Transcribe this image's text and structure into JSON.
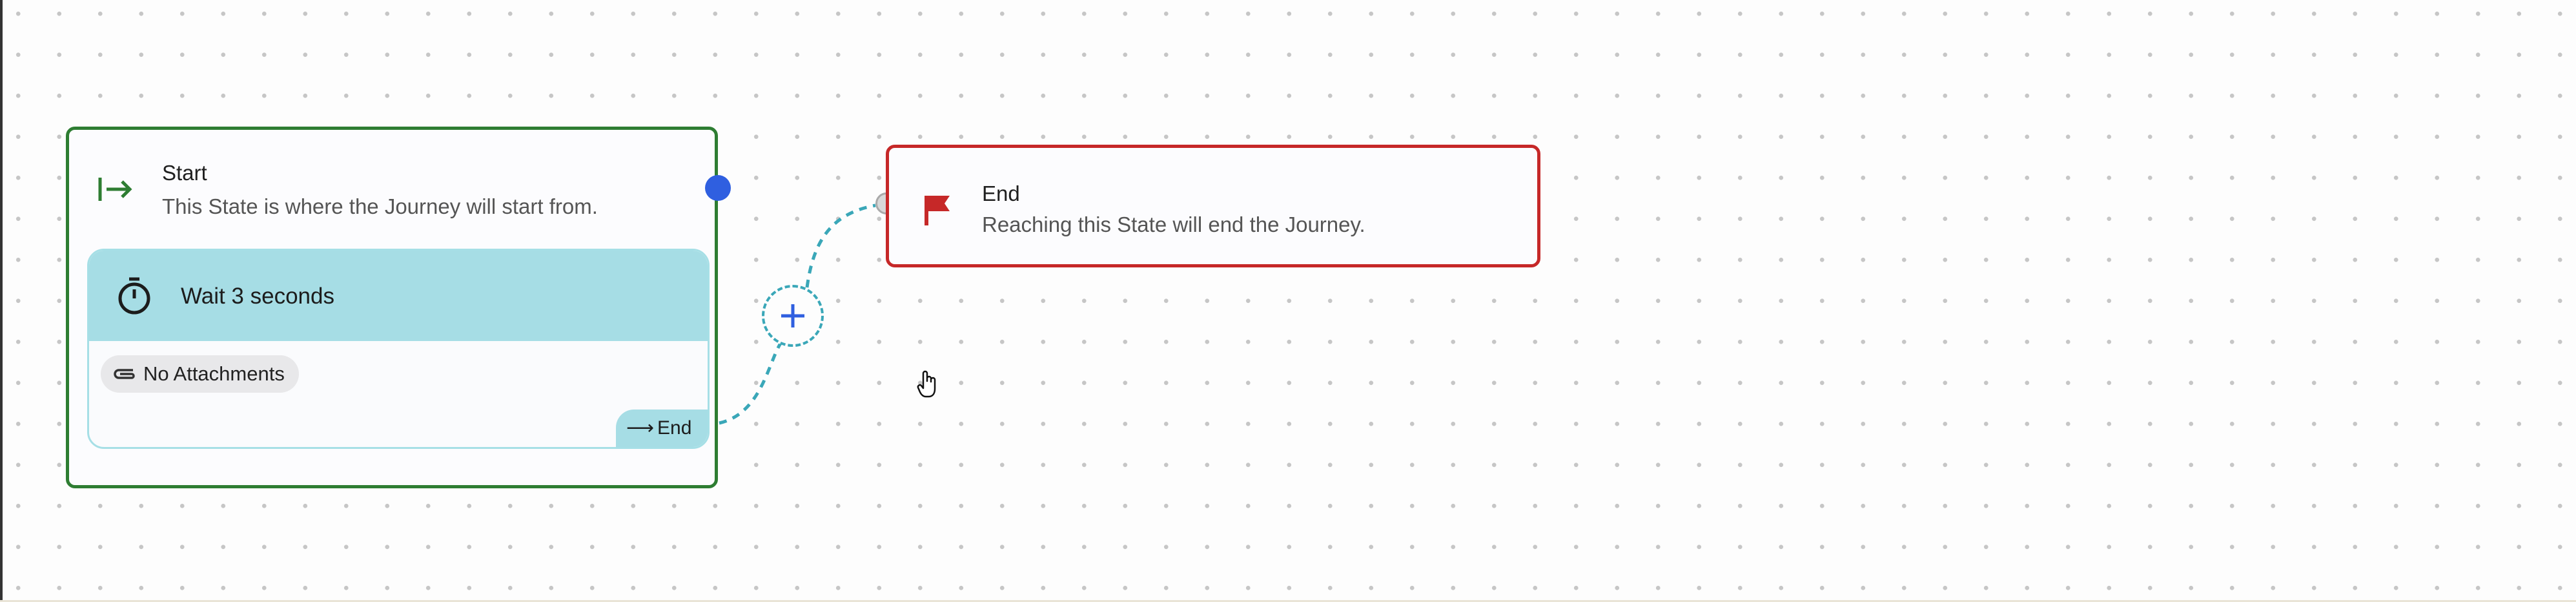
{
  "nodes": {
    "start": {
      "title": "Start",
      "description": "This State is where the Journey will start from.",
      "icon": "arrow-right-to-line-icon",
      "border_color": "#2e7d32",
      "action": {
        "icon": "timer-icon",
        "title": "Wait 3 seconds",
        "attachments_chip": "No Attachments",
        "goto_arrow": "⟶",
        "goto_label": "End",
        "accent_color": "#a6dde5"
      }
    },
    "end": {
      "title": "End",
      "description": "Reaching this State will end the Journey.",
      "icon": "flag-icon",
      "border_color": "#c62828"
    }
  },
  "connector": {
    "style": "dashed",
    "color": "#3aa7b8",
    "add_button_icon": "plus-icon"
  },
  "colors": {
    "output_port": "#2f5fe0",
    "input_port": "#d8d8d8"
  }
}
